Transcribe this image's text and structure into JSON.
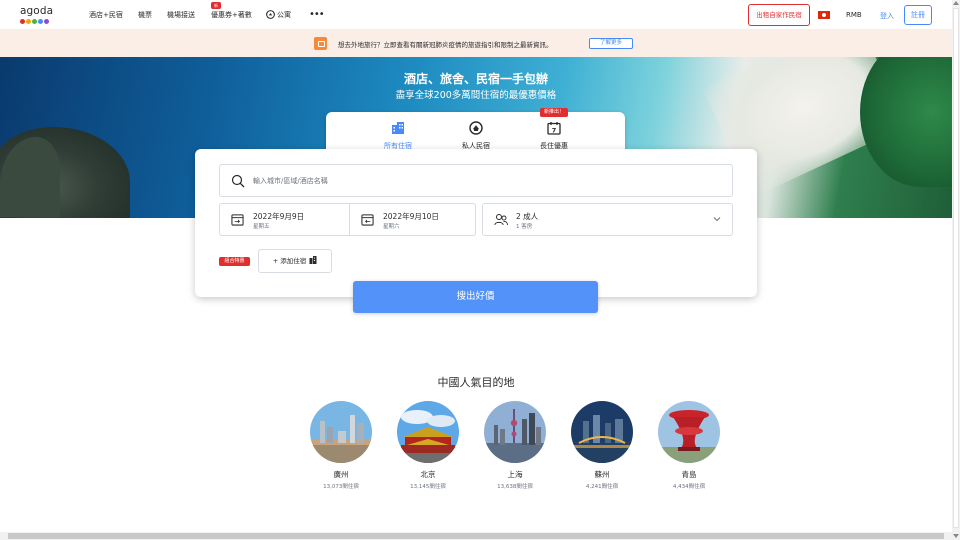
{
  "brand": {
    "logo_text": "agoda",
    "dot_colors": [
      "#e12d2d",
      "#f2a900",
      "#4bb543",
      "#488bf8",
      "#8c4bd6"
    ]
  },
  "nav": {
    "items": [
      {
        "label": "酒店+民宿"
      },
      {
        "label": "機票"
      },
      {
        "label": "機場接送"
      },
      {
        "label": "優惠券+著數",
        "badge": "新"
      },
      {
        "label": "公寓"
      }
    ],
    "more_icon": "more-horizontal-icon",
    "list_property": "出租自家作民宿",
    "currency": "RMB",
    "sign_in": "登入",
    "register": "註冊",
    "flag_icon": "hong-kong-flag-icon"
  },
  "notice": {
    "text": "想去外地旅行？立即查看有關新冠肺炎疫情的旅遊指引和限制之最新資訊。",
    "button": "了解更多"
  },
  "hero": {
    "title": "酒店、旅舍、民宿一手包辦",
    "subtitle": "盡享全球200多萬間住宿的最優惠價格"
  },
  "tabs": [
    {
      "label": "所有住宿",
      "icon": "building-icon",
      "active": true
    },
    {
      "label": "私人民宿",
      "icon": "home-icon",
      "active": false
    },
    {
      "label": "長住優惠",
      "icon": "calendar-7-icon",
      "active": false,
      "badge": "新推出！"
    }
  ],
  "search": {
    "placeholder": "輸入城市/區域/酒店名稱",
    "check_in": {
      "date": "2022年9月9日",
      "weekday": "星期五"
    },
    "check_out": {
      "date": "2022年9月10日",
      "weekday": "星期六"
    },
    "guests": {
      "main": "2 成人",
      "sub": "1 客房"
    },
    "bundle_badge": "組合特惠",
    "add_stay": "+ 添加住宿",
    "submit": "搜出好價"
  },
  "destinations": {
    "title": "中國人氣目的地",
    "items": [
      {
        "city": "廣州",
        "count": "13,073間住宿"
      },
      {
        "city": "北京",
        "count": "13,145間住宿"
      },
      {
        "city": "上海",
        "count": "13,638間住宿"
      },
      {
        "city": "蘇州",
        "count": "4,241間住宿"
      },
      {
        "city": "青島",
        "count": "4,434間住宿"
      }
    ]
  },
  "colors": {
    "accent": "#488bf8",
    "search_button": "#5392f9",
    "badge_red": "#e12d2d",
    "notice_bg": "#fbeee6"
  }
}
